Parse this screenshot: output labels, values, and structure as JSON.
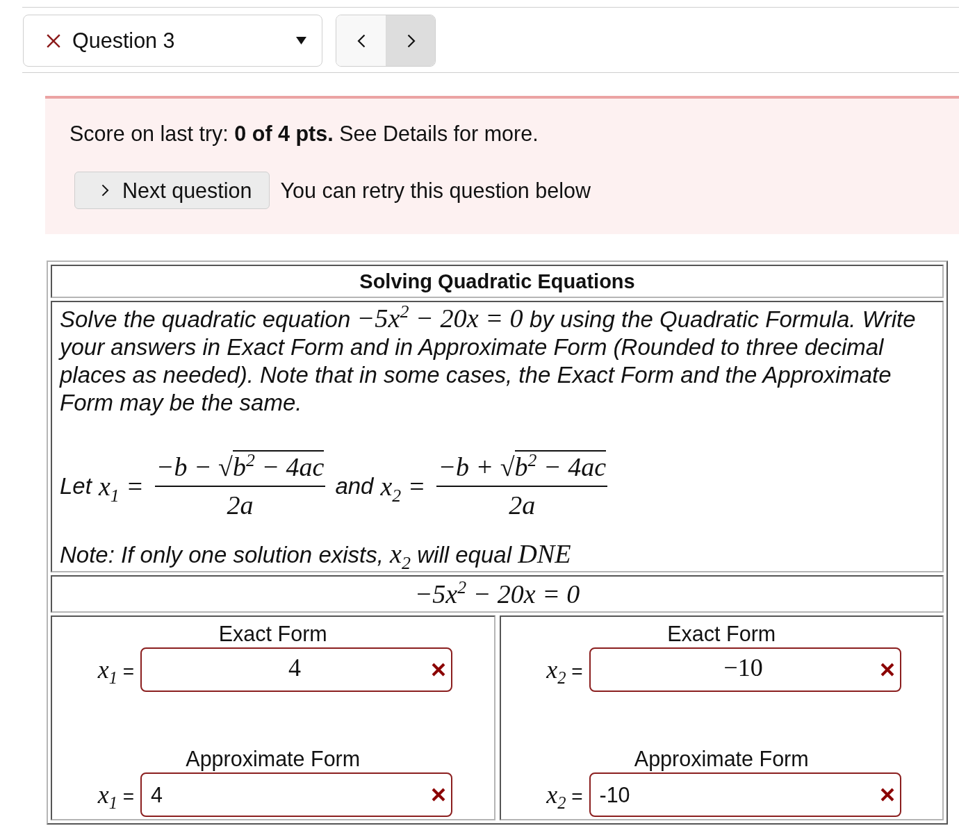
{
  "question_selector": {
    "label": "Question 3",
    "correct": false
  },
  "nav_buttons": [
    {
      "kind": "previous",
      "highlighted": false
    },
    {
      "kind": "next",
      "highlighted": true
    }
  ],
  "alert": {
    "kind": "error",
    "score_text": "Score on last try: **0 of 4 pts.** See Details for more.",
    "next_button": {
      "label": "Next question"
    },
    "retry_text": "You can retry this question below"
  },
  "problem": {
    "title": "Solving Quadratic Equations",
    "instructions": [
      {
        "kind": "text",
        "text": "Solve the quadratic equation "
      },
      {
        "kind": "math",
        "text": "−5x$^{2}$ − 20x = 0"
      },
      {
        "kind": "text",
        "text": " by using the Quadratic Formula. Write your answers in Exact Form and in Approximate Form (Rounded to three decimal places as needed). Note that in some cases, the Exact Form and the Approximate Form may be the same."
      }
    ],
    "formula": [
      {
        "kind": "text",
        "text": "Let "
      },
      {
        "kind": "math",
        "text": "x$_{1}$ ="
      },
      {
        "kind": "fraction",
        "numerator": "−b − √",
        "radicand": "b$^{2}$ − 4ac",
        "denominator": "2a"
      },
      {
        "kind": "text",
        "text": "and "
      },
      {
        "kind": "math",
        "text": "x$_{2}$ ="
      },
      {
        "kind": "fraction",
        "numerator": "−b + √",
        "radicand": "b$^{2}$ − 4ac",
        "denominator": "2a"
      }
    ],
    "note": [
      {
        "kind": "text",
        "text": "Note: If only one solution exists, "
      },
      {
        "kind": "math",
        "text": "x$_{2}$"
      },
      {
        "kind": "text",
        "text": " will equal "
      },
      {
        "kind": "math",
        "text": "DNE"
      }
    ],
    "equation": "−5x$^{2}$ − 20x = 0",
    "answers": [
      {
        "fields": [
          {
            "kind": "math",
            "heading": "Exact Form",
            "variable": "x$_{1}$",
            "relation": "=",
            "value": "4",
            "correct": false
          },
          {
            "kind": "plain",
            "heading": "Approximate Form",
            "variable": "x$_{1}$",
            "relation": "=",
            "value": "4",
            "correct": false
          }
        ]
      },
      {
        "fields": [
          {
            "kind": "math",
            "heading": "Exact Form",
            "variable": "x$_{2}$",
            "relation": "=",
            "value": "−10",
            "correct": false
          },
          {
            "kind": "plain",
            "heading": "Approximate Form",
            "variable": "x$_{2}$",
            "relation": "=",
            "value": "-10",
            "correct": false
          }
        ]
      }
    ]
  }
}
